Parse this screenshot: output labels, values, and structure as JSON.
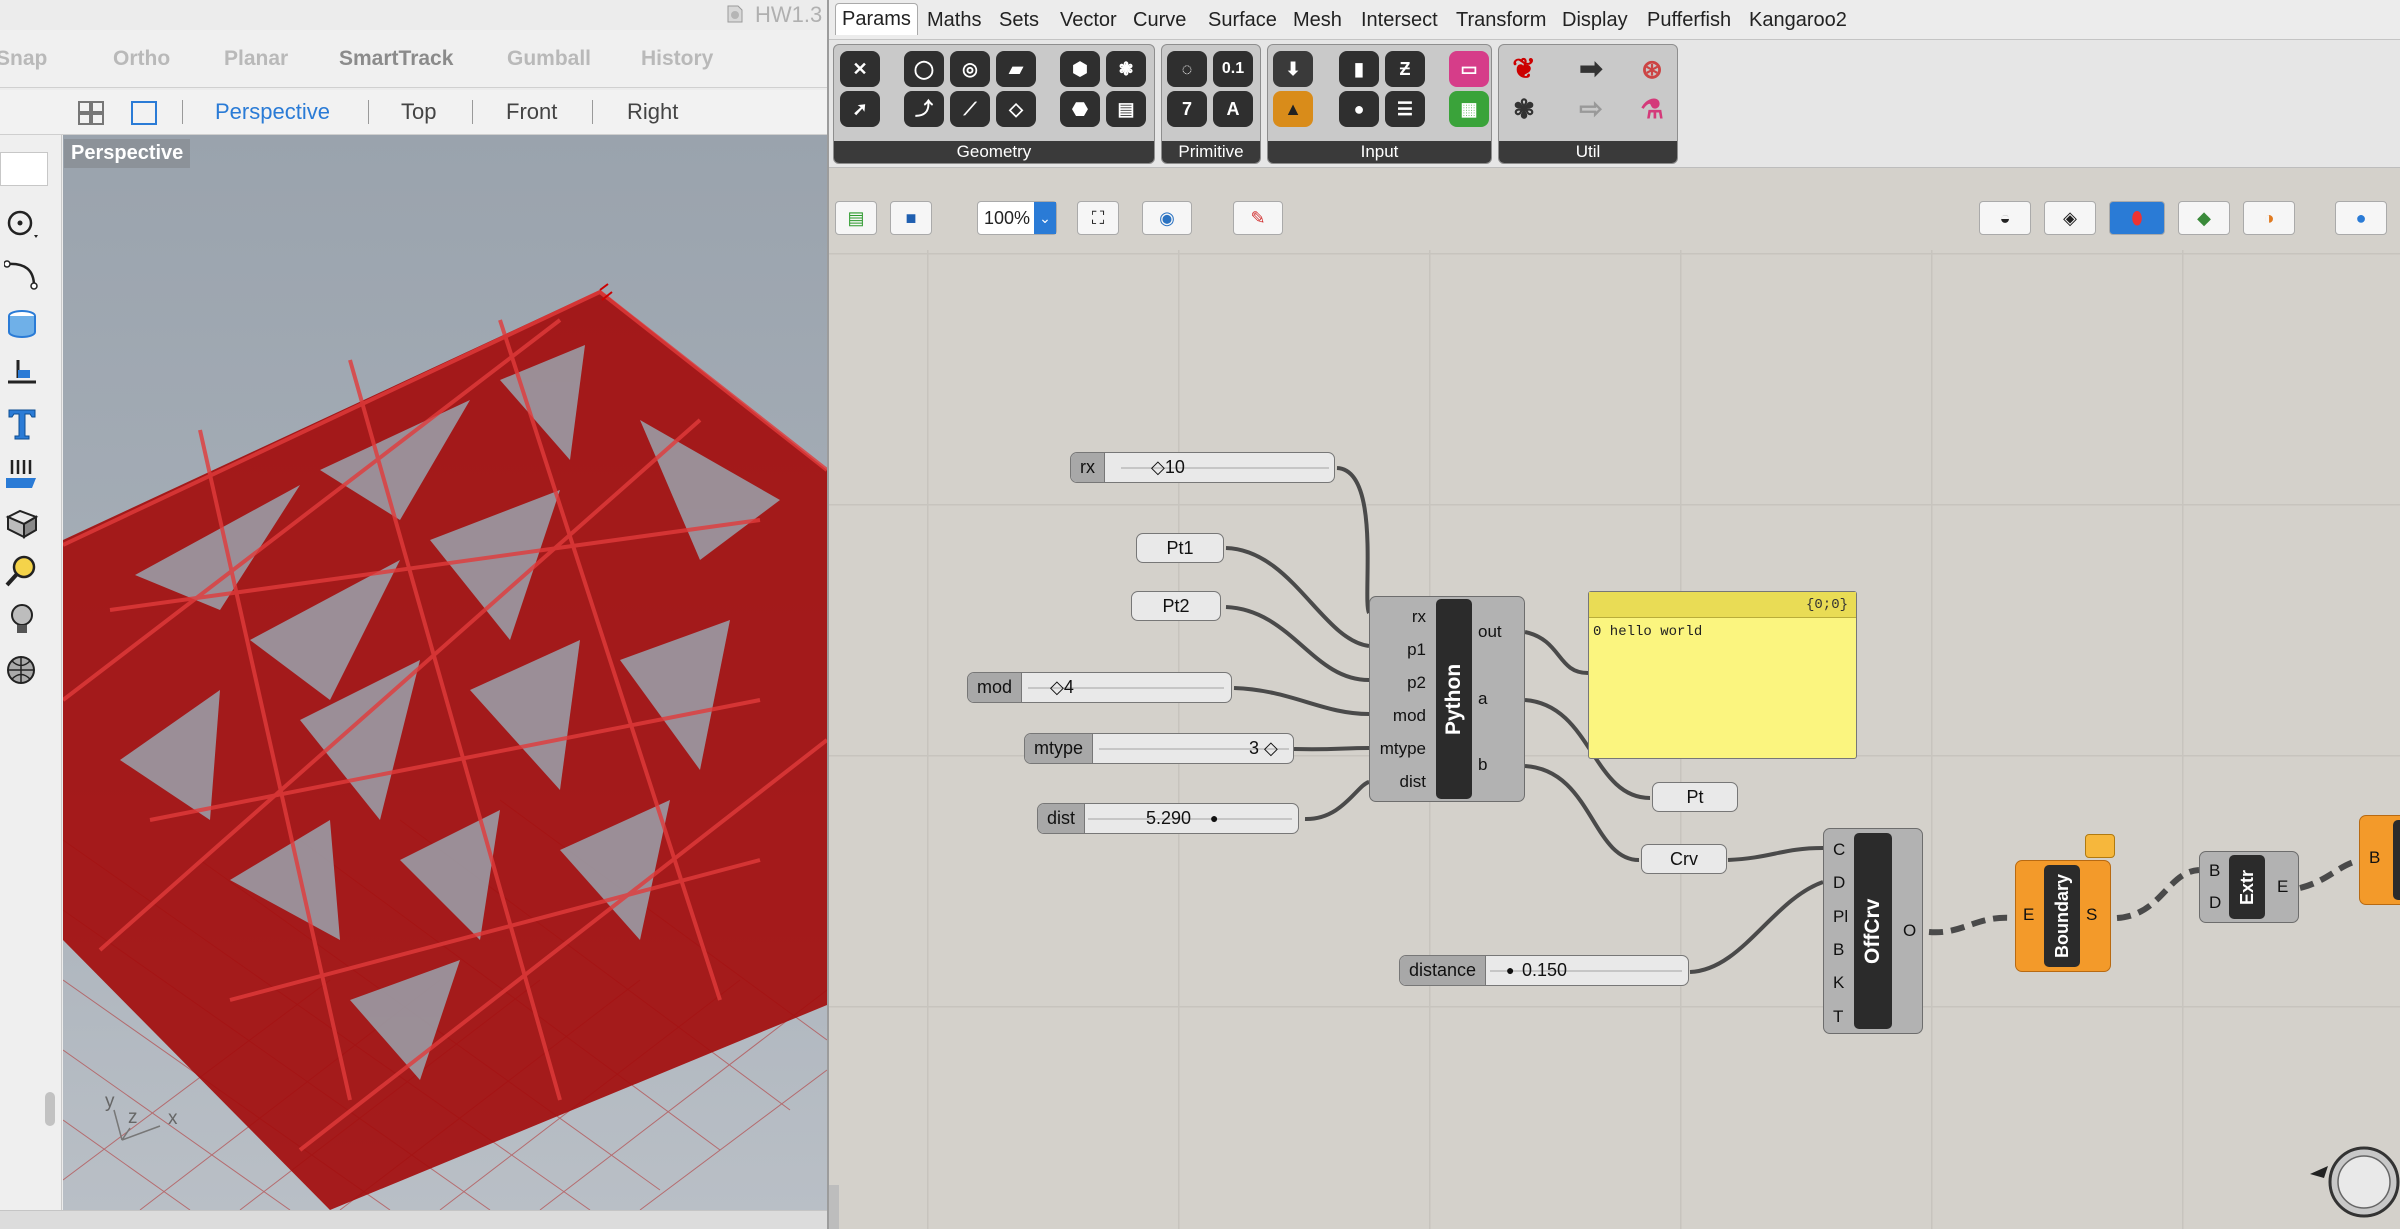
{
  "window": {
    "title": "HW1.3"
  },
  "rhino": {
    "snap_items": [
      "Snap",
      "Ortho",
      "Planar",
      "SmartTrack",
      "Gumball",
      "History"
    ],
    "viewport_tabs": [
      "Perspective",
      "Top",
      "Front",
      "Right"
    ],
    "active_viewport": "Perspective",
    "viewport_label": "Perspective",
    "axes_labels": {
      "x": "x",
      "y": "y",
      "z": "z"
    },
    "model_color": "#b10000"
  },
  "grasshopper": {
    "menu": [
      "Params",
      "Maths",
      "Sets",
      "Vector",
      "Curve",
      "Surface",
      "Mesh",
      "Intersect",
      "Transform",
      "Display",
      "Pufferfish",
      "Kangaroo2"
    ],
    "active_menu": "Params",
    "ribbon_panels": [
      "Geometry",
      "Primitive",
      "Input",
      "Util"
    ],
    "primitive_labels": [
      "0.1",
      "7",
      "A"
    ],
    "zoom": "100%",
    "sliders": {
      "rx": {
        "name": "rx",
        "value": "◇10"
      },
      "mod": {
        "name": "mod",
        "value": "◇4"
      },
      "mtype": {
        "name": "mtype",
        "value": "3 ◇"
      },
      "dist": {
        "name": "dist",
        "value": "5.290"
      },
      "distance": {
        "name": "distance",
        "value": "0.150"
      }
    },
    "params": {
      "pt1": "Pt1",
      "pt2": "Pt2",
      "pt": "Pt",
      "crv": "Crv"
    },
    "python": {
      "name": "Python",
      "inputs": [
        "rx",
        "p1",
        "p2",
        "mod",
        "mtype",
        "dist"
      ],
      "outputs": [
        "out",
        "a",
        "b"
      ]
    },
    "panel": {
      "header": "{0;0}",
      "line": "0 hello world"
    },
    "offcrv": {
      "name": "OffCrv",
      "inputs": [
        "C",
        "D",
        "Pl",
        "B",
        "K",
        "T"
      ],
      "output": "O"
    },
    "boundary": {
      "name": "Boundary",
      "input": "E",
      "output": "S"
    },
    "extr": {
      "name": "Extr",
      "inputs": [
        "B",
        "D"
      ],
      "output": "E"
    },
    "edge_comp": {
      "input": "B"
    },
    "accent_orange": "#f39a2a",
    "note_yellow": "#fbf57f"
  }
}
